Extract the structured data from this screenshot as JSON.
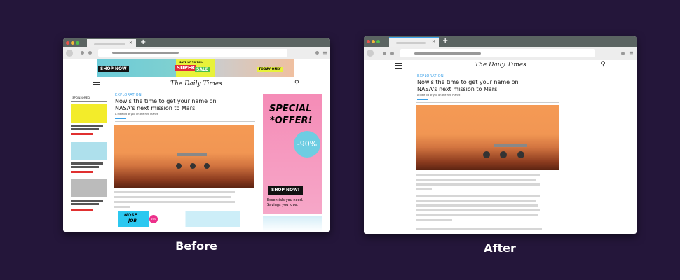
{
  "before": {
    "label": "Before",
    "site_title": "The Daily Times",
    "category": "EXPLORATION",
    "headline_1": "Now's the time to get your name on",
    "headline_2": "NASA's next mission to Mars",
    "subhead": "A little bit of you on the Red Planet",
    "sponsored_label": "SPONSORED",
    "banner_ad": {
      "cta": "SHOP NOW",
      "promo": "SAVE UP TO 70%",
      "super": "SUPER",
      "sale": "SALE",
      "today": "TODAY ONLY"
    },
    "side_ad": {
      "line1": "SPECIAL",
      "line2": "*OFFER!",
      "discount": "-90%",
      "cta": "SHOP NOW!",
      "tagline_1": "Essentials you need.",
      "tagline_2": "Savings you love."
    },
    "bottom_ad": {
      "line1": "NOSE",
      "line2": "JOB",
      "badge": "20% OFF"
    }
  },
  "after": {
    "label": "After",
    "site_title": "The Daily Times",
    "category": "EXPLORATION",
    "headline_1": "Now's the time to get your name on",
    "headline_2": "NASA's next mission to Mars",
    "subhead": "A little bit of you on the Red Planet"
  },
  "colors": {
    "background": "#24163a",
    "accent": "#3aa0e8",
    "mars": "#f59a55"
  }
}
